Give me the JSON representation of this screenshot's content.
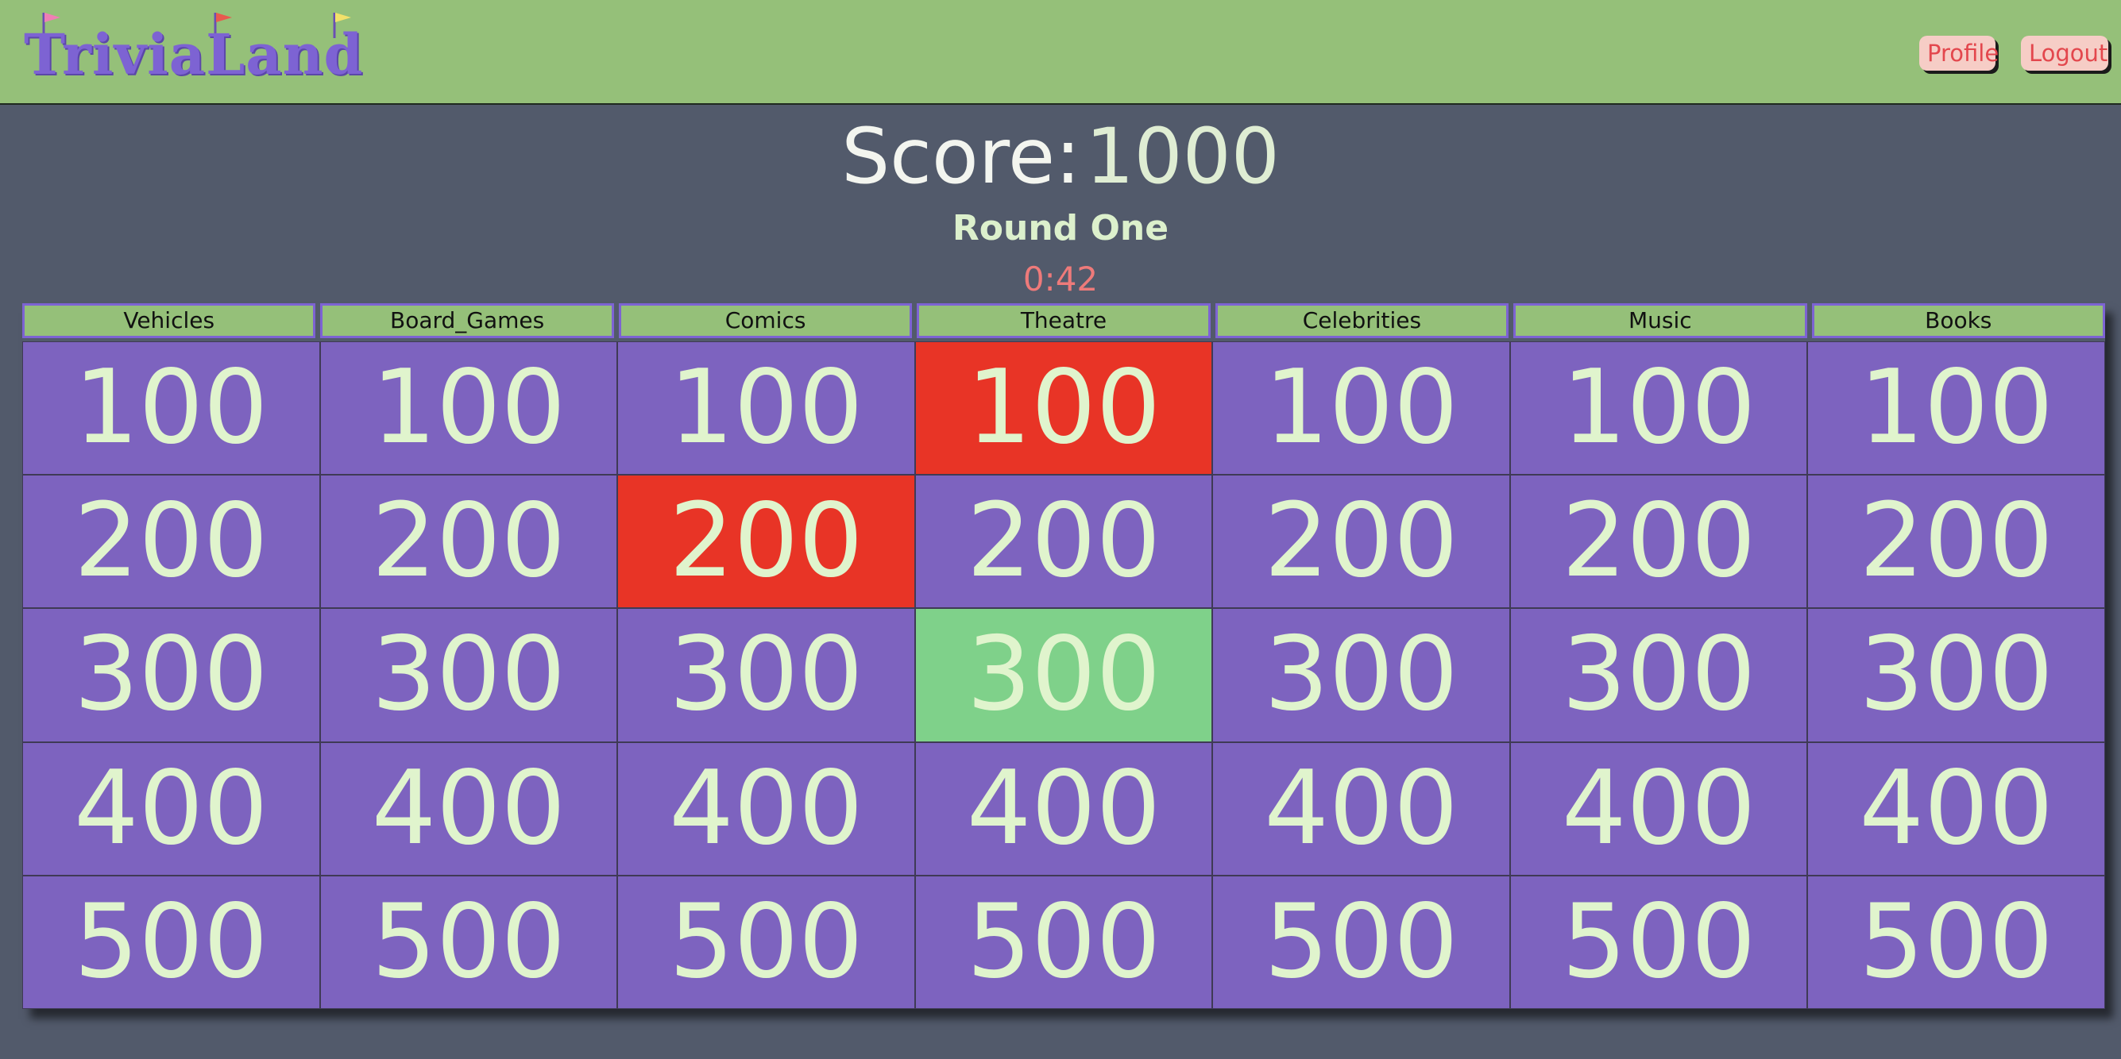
{
  "header": {
    "logo_text": "TriviaLand",
    "profile_label": "Profile",
    "logout_label": "Logout"
  },
  "status": {
    "score_label": "Score:",
    "score_value": "1000",
    "round": "Round One",
    "timer": "0:42"
  },
  "board": {
    "categories": [
      "Vehicles",
      "Board_Games",
      "Comics",
      "Theatre",
      "Celebrities",
      "Music",
      "Books"
    ],
    "row_values": [
      "100",
      "200",
      "300",
      "400",
      "500"
    ],
    "cell_states": {
      "Comics-200": "wrong",
      "Theatre-100": "wrong",
      "Theatre-300": "correct"
    }
  },
  "colors": {
    "header_bg": "#95c079",
    "page_bg": "#525a6b",
    "cell_bg": "#7d63bf",
    "cell_text": "#e0f4cd",
    "wrong_bg": "#e83426",
    "correct_bg": "#7fd18a",
    "logo": "#7d63d3",
    "timer": "#ee7a7a"
  },
  "icons": {
    "flags": [
      "flag-pink-icon",
      "flag-red-icon",
      "flag-yellow-icon"
    ]
  }
}
